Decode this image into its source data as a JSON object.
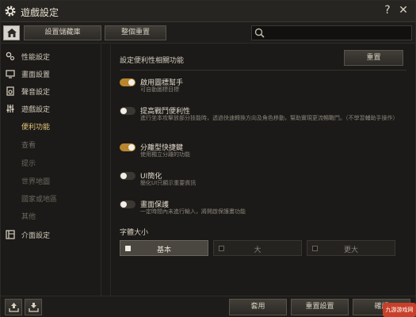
{
  "window": {
    "title": "遊戲設定",
    "help": "?",
    "close": "✕"
  },
  "toolbar": {
    "manage_label": "設置儲藏庫",
    "reset_all_label": "整個重置",
    "search": {
      "placeholder": "",
      "value": ""
    }
  },
  "sidebar": {
    "items": [
      {
        "label": "性能設定",
        "icon": "performance-icon"
      },
      {
        "label": "畫面設置",
        "icon": "monitor-icon"
      },
      {
        "label": "聲音設定",
        "icon": "speaker-icon"
      },
      {
        "label": "遊戲設定",
        "icon": "sliders-icon"
      },
      {
        "label": "介面設定",
        "icon": "interface-icon"
      }
    ],
    "subitems": [
      "便利功能",
      "查看",
      "提示",
      "世界地圖",
      "國家或地區",
      "其他"
    ],
    "active_subitem": "便利功能"
  },
  "main": {
    "section_title": "設定便利性相關功能",
    "reset_label": "重置",
    "options": [
      {
        "label": "啟用圖標幫手",
        "desc": "可自動圖標目標",
        "on": true
      },
      {
        "label": "提高戰鬥便利性",
        "desc": "進行坐本攻擊放部分技能時，透過快速轉換方向及角色移動，幫助實現更流暢戰鬥。（不學習輔助手操作）",
        "on": false
      },
      {
        "label": "分離型快捷鍵",
        "desc": "使用獨立分離的功能",
        "on": true
      },
      {
        "label": "UI簡化",
        "desc": "簡化UI只顯示重要資訊",
        "on": false
      },
      {
        "label": "畫面保護",
        "desc": "一定時間內未進行輸入，將開啟保護畫功能",
        "on": false
      }
    ],
    "font_size": {
      "title": "字體大小",
      "options": [
        "基本",
        "大",
        "更大"
      ],
      "selected": "基本"
    }
  },
  "bottom": {
    "apply_label": "套用",
    "reset_settings_label": "重置設置",
    "confirm_label": "確認",
    "watermark": "九游游戏网"
  },
  "colors": {
    "accent": "#b8862e",
    "active_text": "#e6c77a",
    "background": "#1b1a18"
  }
}
